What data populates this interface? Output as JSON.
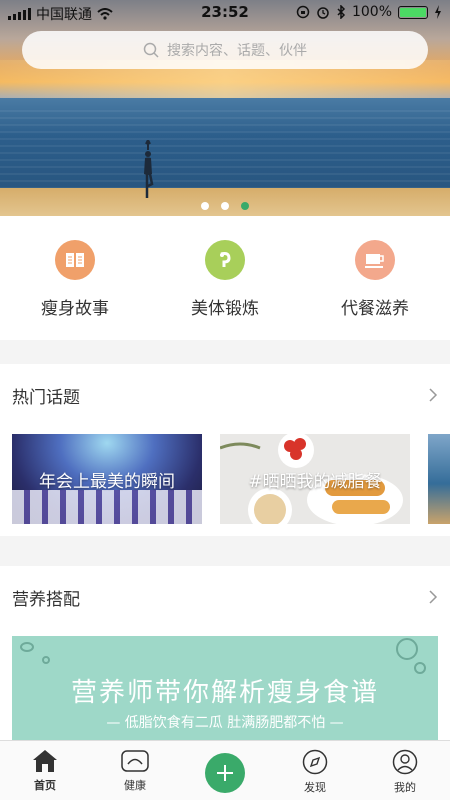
{
  "status_bar": {
    "carrier": "中国联通",
    "time": "23:52",
    "battery": "100%",
    "battery_level": 1.0
  },
  "search": {
    "placeholder": "搜索内容、话题、伙伴",
    "icon": "search-icon"
  },
  "carousel": {
    "count": 3,
    "active_index": 2
  },
  "categories": [
    {
      "label": "瘦身故事",
      "icon": "book-icon",
      "color": "#f0a06a"
    },
    {
      "label": "美体锻炼",
      "icon": "dumbbell-icon",
      "color": "#a8cf5a"
    },
    {
      "label": "代餐滋养",
      "icon": "cup-icon",
      "color": "#f3a88c"
    }
  ],
  "hot_topics": {
    "title": "热门话题",
    "items": [
      {
        "label": "年会上最美的瞬间"
      },
      {
        "label": "#晒晒我的减脂餐"
      }
    ]
  },
  "nutrition": {
    "title": "营养搭配",
    "banner_title": "营养师带你解析瘦身食谱",
    "banner_subtitle": "低脂饮食有二瓜 肚满肠肥都不怕"
  },
  "tabbar": [
    {
      "label": "首页",
      "icon": "home-icon",
      "active": true
    },
    {
      "label": "健康",
      "icon": "health-icon",
      "active": false
    },
    {
      "label": "",
      "icon": "plus-icon",
      "active": false
    },
    {
      "label": "发现",
      "icon": "compass-icon",
      "active": false
    },
    {
      "label": "我的",
      "icon": "profile-icon",
      "active": false
    }
  ],
  "colors": {
    "accent": "#3aaa6a",
    "banner": "#9ed8c8"
  }
}
